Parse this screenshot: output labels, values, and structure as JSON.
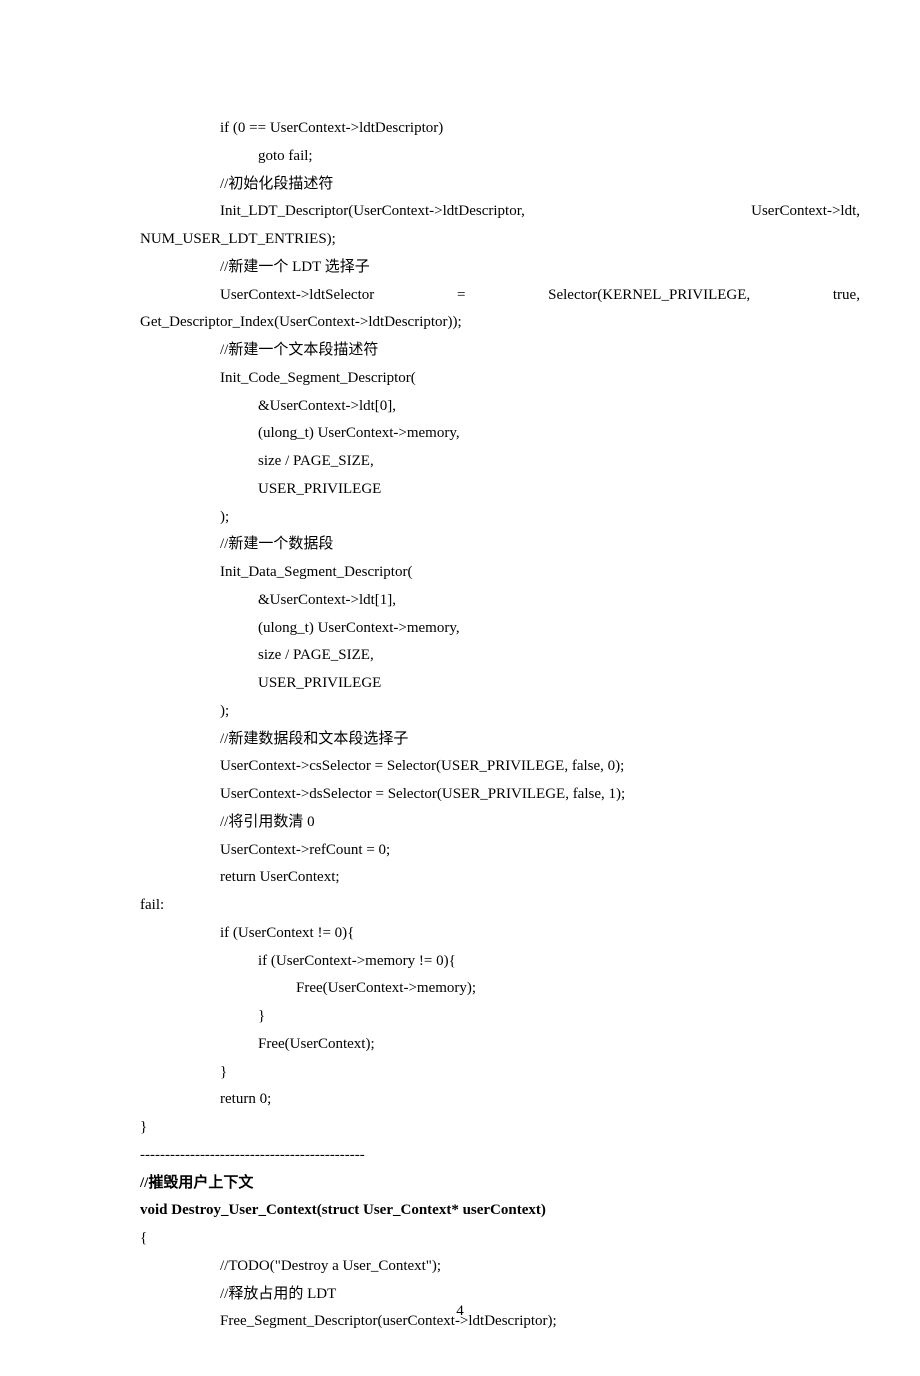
{
  "lines": [
    {
      "cls": "indent2",
      "text": "if (0 == UserContext->ldtDescriptor)"
    },
    {
      "cls": "indent3",
      "text": "goto fail;"
    },
    {
      "cls": "indent2",
      "text": "//初始化段描述符"
    },
    {
      "cls": "indent2",
      "type": "justify",
      "parts": [
        "Init_LDT_Descriptor(UserContext->ldtDescriptor,",
        "UserContext->ldt,"
      ]
    },
    {
      "cls": "",
      "text": "NUM_USER_LDT_ENTRIES);"
    },
    {
      "cls": "indent2",
      "text": "//新建一个 LDT 选择子"
    },
    {
      "cls": "indent2",
      "type": "justify",
      "parts": [
        "UserContext->ldtSelector",
        "=",
        "Selector(KERNEL_PRIVILEGE,",
        "true,"
      ]
    },
    {
      "cls": "",
      "text": "Get_Descriptor_Index(UserContext->ldtDescriptor));"
    },
    {
      "cls": "indent2",
      "text": "//新建一个文本段描述符"
    },
    {
      "cls": "indent2",
      "text": "Init_Code_Segment_Descriptor("
    },
    {
      "cls": "indent3",
      "text": "&UserContext->ldt[0],"
    },
    {
      "cls": "indent3",
      "text": "(ulong_t) UserContext->memory,"
    },
    {
      "cls": "indent3",
      "text": "size / PAGE_SIZE,"
    },
    {
      "cls": "indent3",
      "text": "USER_PRIVILEGE"
    },
    {
      "cls": "indent2",
      "text": ");"
    },
    {
      "cls": "indent2",
      "text": "//新建一个数据段"
    },
    {
      "cls": "indent2",
      "text": "Init_Data_Segment_Descriptor("
    },
    {
      "cls": "indent3",
      "text": "&UserContext->ldt[1],"
    },
    {
      "cls": "indent3",
      "text": "(ulong_t) UserContext->memory,"
    },
    {
      "cls": "indent3",
      "text": "size / PAGE_SIZE,"
    },
    {
      "cls": "indent3",
      "text": "USER_PRIVILEGE"
    },
    {
      "cls": "indent2",
      "text": ");"
    },
    {
      "cls": "indent2",
      "text": "//新建数据段和文本段选择子"
    },
    {
      "cls": "indent2",
      "text": "UserContext->csSelector = Selector(USER_PRIVILEGE, false, 0);"
    },
    {
      "cls": "indent2",
      "text": "UserContext->dsSelector = Selector(USER_PRIVILEGE, false, 1);"
    },
    {
      "cls": "indent2",
      "text": "//将引用数清 0"
    },
    {
      "cls": "indent2",
      "text": "UserContext->refCount = 0;"
    },
    {
      "cls": "indent2",
      "text": "return UserContext;"
    },
    {
      "cls": "",
      "text": "fail:"
    },
    {
      "cls": "indent2",
      "text": "if (UserContext != 0){"
    },
    {
      "cls": "indent3",
      "text": "if (UserContext->memory != 0){"
    },
    {
      "cls": "indent4",
      "text": "Free(UserContext->memory);"
    },
    {
      "cls": "indent3",
      "text": "}"
    },
    {
      "cls": "indent3",
      "text": "Free(UserContext);"
    },
    {
      "cls": "indent2",
      "text": "}"
    },
    {
      "cls": "indent2",
      "text": "return 0;"
    },
    {
      "cls": "",
      "text": "}"
    },
    {
      "cls": "",
      "text": "---------------------------------------------"
    },
    {
      "cls": "",
      "text": "//摧毁用户上下文",
      "bold": true
    },
    {
      "cls": "",
      "text": "void Destroy_User_Context(struct User_Context* userContext)",
      "bold": true
    },
    {
      "cls": "",
      "text": "{"
    },
    {
      "cls": "indent2",
      "text": "//TODO(\"Destroy a User_Context\");"
    },
    {
      "cls": "indent2",
      "text": "//释放占用的 LDT"
    },
    {
      "cls": "indent2",
      "text": "Free_Segment_Descriptor(userContext->ldtDescriptor);"
    }
  ],
  "pageNumber": "4"
}
